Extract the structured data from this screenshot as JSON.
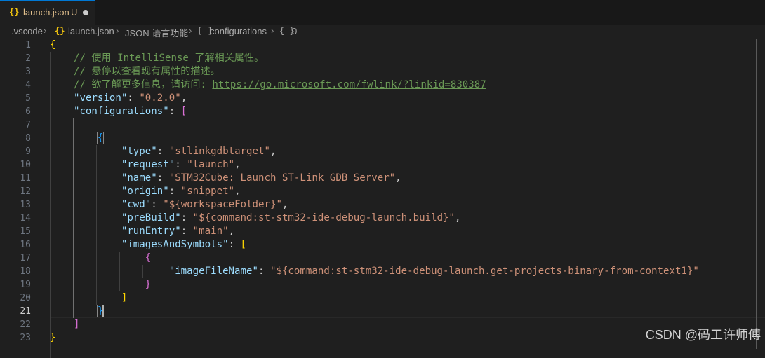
{
  "tab": {
    "icon": "{}",
    "filename": "launch.json",
    "status": "U"
  },
  "breadcrumb": {
    "folder": ".vscode",
    "file_icon": "{}",
    "file": "launch.json",
    "section": "JSON 语言功能",
    "array_icon": "[ ]",
    "array": "configurations",
    "object_icon": "{ }",
    "index": "0"
  },
  "editor": {
    "active_line": 21,
    "line_numbers": [
      "1",
      "2",
      "3",
      "4",
      "5",
      "6",
      "7",
      "8",
      "9",
      "10",
      "11",
      "12",
      "13",
      "14",
      "15",
      "16",
      "17",
      "18",
      "19",
      "20",
      "21",
      "22",
      "23"
    ],
    "text": {
      "brace_open": "{",
      "brace_close": "}",
      "bracket_open": "[",
      "bracket_close": "]",
      "comment1": "// 使用 IntelliSense 了解相关属性。",
      "comment2": "// 悬停以查看现有属性的描述。",
      "comment3_prefix": "// 欲了解更多信息，请访问: ",
      "comment3_link": "https://go.microsoft.com/fwlink/?linkid=830387",
      "version_key": "\"version\"",
      "version_val": "\"0.2.0\"",
      "configurations_key": "\"configurations\"",
      "type_key": "\"type\"",
      "type_val": "\"stlinkgdbtarget\"",
      "request_key": "\"request\"",
      "request_val": "\"launch\"",
      "name_key": "\"name\"",
      "name_val": "\"STM32Cube: Launch ST-Link GDB Server\"",
      "origin_key": "\"origin\"",
      "origin_val": "\"snippet\"",
      "cwd_key": "\"cwd\"",
      "cwd_val": "\"${workspaceFolder}\"",
      "prebuild_key": "\"preBuild\"",
      "prebuild_val": "\"${command:st-stm32-ide-debug-launch.build}\"",
      "runentry_key": "\"runEntry\"",
      "runentry_val": "\"main\"",
      "images_key": "\"imagesAndSymbols\"",
      "imagefile_key": "\"imageFileName\"",
      "imagefile_val": "\"${command:st-stm32-ide-debug-launch.get-projects-binary-from-context1}\""
    }
  },
  "watermark": "CSDN @码工许师傅",
  "colors": {
    "background": "#1f1f1f",
    "key": "#9cdcfe",
    "string": "#ce9178",
    "comment": "#6a9955",
    "bracket_level1": "#ffd700",
    "bracket_level2": "#da70d6",
    "bracket_level3": "#179fff",
    "tab_accent": "#0078d4"
  }
}
